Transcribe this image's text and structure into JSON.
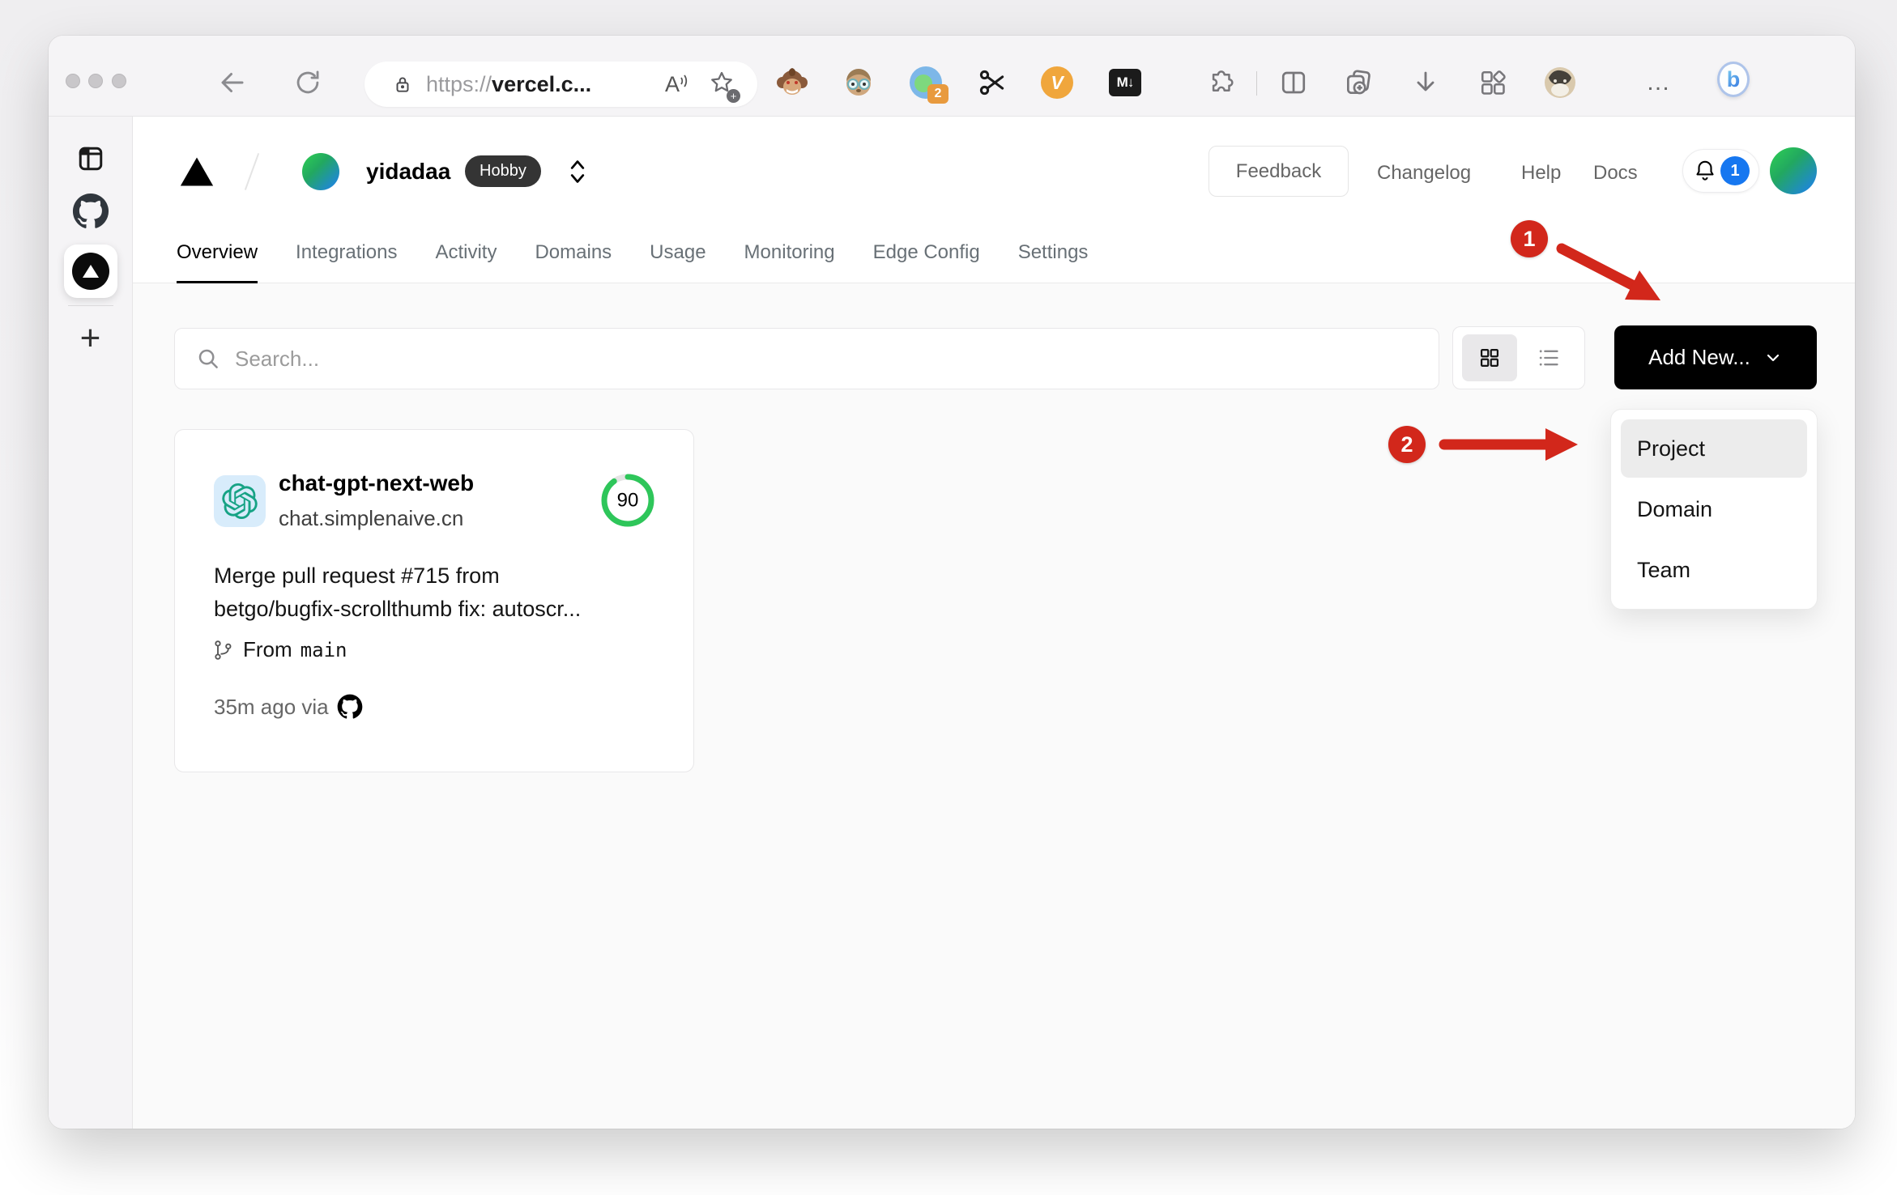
{
  "colors": {
    "annotation_red": "#d2271b",
    "notification_blue": "#1677f0",
    "score_green": "#2ec65a",
    "brand_black": "#000000"
  },
  "browser": {
    "url": {
      "scheme": "https://",
      "host": "vercel.c..."
    },
    "reader_glyph": "A",
    "extensions": {
      "tab_count_badge": "2",
      "video_glyph": "V",
      "markdown_glyph": "M↓"
    },
    "more_glyph": "…",
    "bing_glyph": "b"
  },
  "edge_sidebar": {
    "plus_glyph": "+"
  },
  "header": {
    "team": "yidadaa",
    "plan": "Hobby",
    "feedback": "Feedback",
    "links": [
      {
        "label": "Changelog"
      },
      {
        "label": "Help"
      },
      {
        "label": "Docs"
      }
    ],
    "notification_count": "1"
  },
  "nav": {
    "tabs": [
      {
        "label": "Overview",
        "active": true
      },
      {
        "label": "Integrations"
      },
      {
        "label": "Activity"
      },
      {
        "label": "Domains"
      },
      {
        "label": "Usage"
      },
      {
        "label": "Monitoring"
      },
      {
        "label": "Edge Config"
      },
      {
        "label": "Settings"
      }
    ]
  },
  "controls": {
    "search_placeholder": "Search...",
    "add_new": "Add New..."
  },
  "dropdown": {
    "items": [
      {
        "label": "Project",
        "highlighted": true
      },
      {
        "label": "Domain"
      },
      {
        "label": "Team"
      }
    ]
  },
  "project": {
    "name": "chat-gpt-next-web",
    "domain": "chat.simplenaive.cn",
    "score": "90",
    "commit_line1": "Merge pull request #715 from",
    "commit_line2": "betgo/bugfix-scrollthumb fix: autoscr...",
    "branch_label": "From",
    "branch_name": "main",
    "time": "35m ago via"
  },
  "annotations": {
    "step1": "1",
    "step2": "2"
  }
}
